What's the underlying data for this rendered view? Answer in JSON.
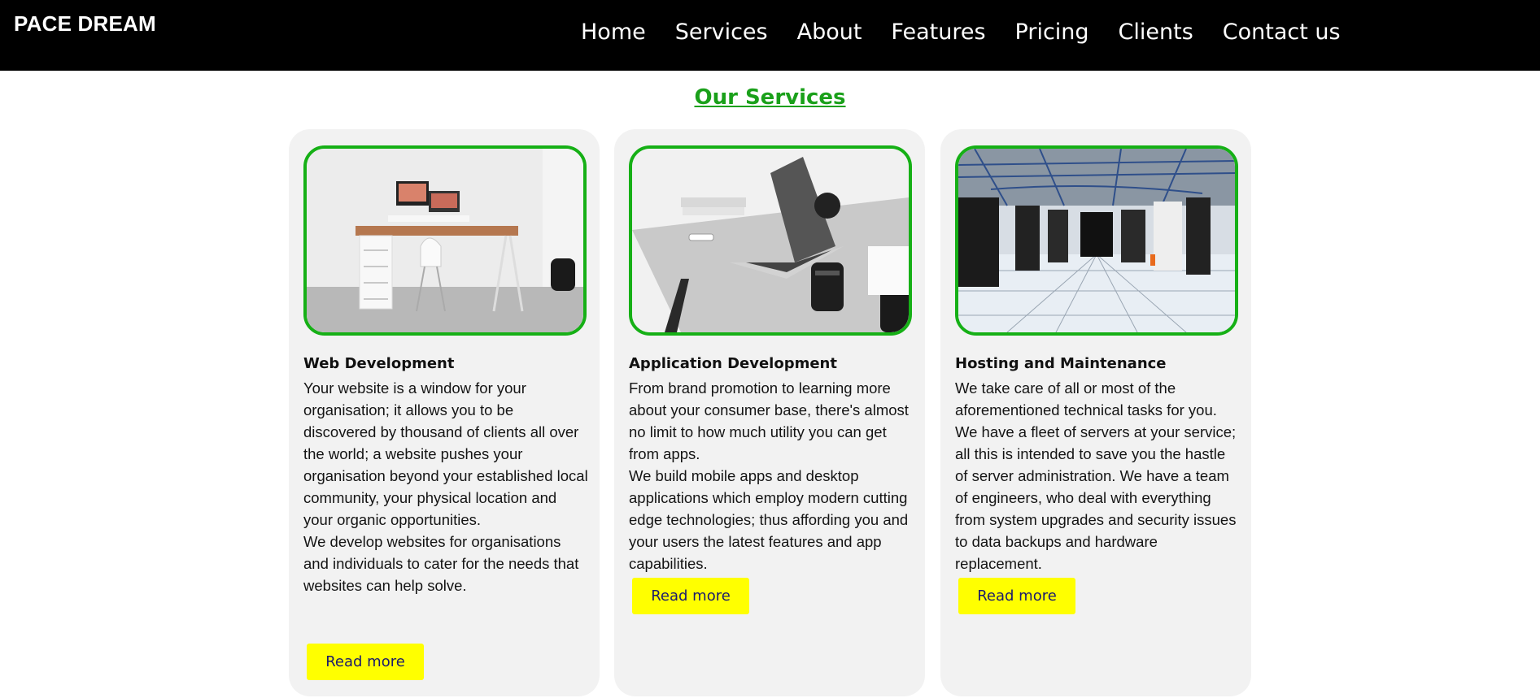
{
  "brand": "PACE DREAM",
  "nav": [
    "Home",
    "Services",
    "About",
    "Features",
    "Pricing",
    "Clients",
    "Contact us"
  ],
  "section_title": "Our Services",
  "colors": {
    "nav_bg": "#000000",
    "accent_green": "#16b016",
    "card_bg": "#f2f2f2",
    "button_bg": "#ffff00",
    "button_text": "#1a1a6e"
  },
  "cards": [
    {
      "image": "desk-workspace-photo",
      "title": "Web Development",
      "paragraphs": [
        "Your website is a window for your organisation; it allows you to be discovered by thousand of clients all over the world; a website pushes your organisation beyond your established local community, your physical location and your organic opportunities.",
        "We develop websites for organisations and individuals to cater for the needs that websites can help solve."
      ],
      "button": "Read more"
    },
    {
      "image": "laptop-on-desk-photo",
      "title": "Application Development",
      "paragraphs": [
        "From brand promotion to learning more about your consumer base, there's almost no limit to how much utility you can get from apps.",
        "We build mobile apps and desktop applications which employ modern cutting edge technologies; thus affording you and your users the latest features and app capabilities."
      ],
      "button": "Read more"
    },
    {
      "image": "server-room-photo",
      "title": "Hosting and Maintenance",
      "paragraphs": [
        "We take care of all or most of the aforementioned technical tasks for you. We have a fleet of servers at your service; all this is intended to save you the hastle of server administration. We have a team of engineers, who deal with everything from system upgrades and security issues to data backups and hardware replacement."
      ],
      "button": "Read more"
    }
  ]
}
